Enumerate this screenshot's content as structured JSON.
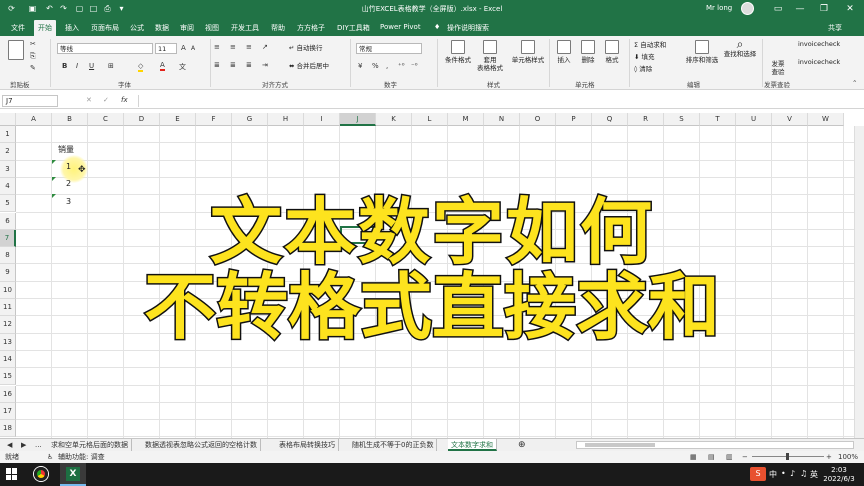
{
  "titlebar": {
    "title": "山竹EXCEL表格教学（全屏版）.xlsx - Excel",
    "user": "Mr long",
    "qa_icons": [
      "save-icon",
      "undo-icon",
      "redo-icon",
      "open-icon",
      "new-icon",
      "print-icon"
    ],
    "window_controls": [
      "ribbon-display-icon",
      "minimize-icon",
      "restore-icon",
      "close-icon"
    ],
    "minimize": "—",
    "restore": "❐",
    "close": "✕",
    "ribbon_display": "▭"
  },
  "tabs": {
    "items": [
      "文件",
      "开始",
      "插入",
      "页面布局",
      "公式",
      "数据",
      "审阅",
      "视图",
      "开发工具",
      "帮助",
      "方方格子",
      "DIY工具箱",
      "Power Pivot"
    ],
    "active": "开始",
    "tell_me": "操作说明搜索",
    "share": "共享"
  },
  "ribbon": {
    "clipboard": {
      "label": "剪贴板"
    },
    "font": {
      "label": "字体",
      "name": "等线",
      "size": "11",
      "bold": "B",
      "italic": "I",
      "underline": "U",
      "font_color_glyph": "A"
    },
    "alignment": {
      "label": "对齐方式",
      "wrap": "自动换行",
      "merge": "合并后居中"
    },
    "number": {
      "label": "数字",
      "format": "常规",
      "percent": "%",
      "comma": ",",
      "currency": "¥"
    },
    "styles": {
      "label": "样式",
      "conditional": "条件格式",
      "table": "套用\n表格格式",
      "cell": "单元格样式"
    },
    "cells": {
      "label": "单元格",
      "insert": "插入",
      "delete": "删除",
      "format": "格式"
    },
    "editing": {
      "label": "编辑",
      "autosum": "自动求和",
      "fill": "填充",
      "clear": "清除",
      "sort": "排序和筛选",
      "find": "查找和选择"
    },
    "invoice": {
      "label": "发票查验",
      "btn": "发票\n查验",
      "check1": "invoicecheck",
      "check2": "invoicecheck"
    }
  },
  "formula_bar": {
    "name_box": "J7",
    "cancel": "✕",
    "enter": "✓",
    "fx": "fx",
    "value": ""
  },
  "grid": {
    "columns": [
      "A",
      "B",
      "C",
      "D",
      "E",
      "F",
      "G",
      "H",
      "I",
      "J",
      "K",
      "L",
      "M",
      "N",
      "O",
      "P",
      "Q",
      "R",
      "S",
      "T",
      "U",
      "V",
      "W"
    ],
    "rows": [
      "1",
      "2",
      "3",
      "4",
      "5",
      "6",
      "7",
      "8",
      "9",
      "10",
      "11",
      "12",
      "13",
      "14",
      "15",
      "16",
      "17",
      "18"
    ],
    "selected_col": "J",
    "selected_row": "7",
    "b2": "销量",
    "b3": "1",
    "b4": "2",
    "b5": "3"
  },
  "overlay": {
    "line1": "文本数字如何",
    "line2": "不转格式直接求和"
  },
  "sheet_tabs": {
    "nav_prev": "◀",
    "nav_next": "▶",
    "more": "...",
    "items": [
      "求和空单元格后面的数据",
      "数据透视表忽略公式返回的空格计数",
      "表格布局转换技巧",
      "随机生成不等于0的正负数",
      "文本数字求和"
    ],
    "active": "文本数字求和",
    "add": "⊕"
  },
  "status": {
    "ready": "就绪",
    "accessibility": "辅助功能: 调查",
    "zoom": "100%"
  },
  "taskbar": {
    "time": "2:03",
    "date": "2022/6/3",
    "ime": "中",
    "ime2": "英"
  }
}
